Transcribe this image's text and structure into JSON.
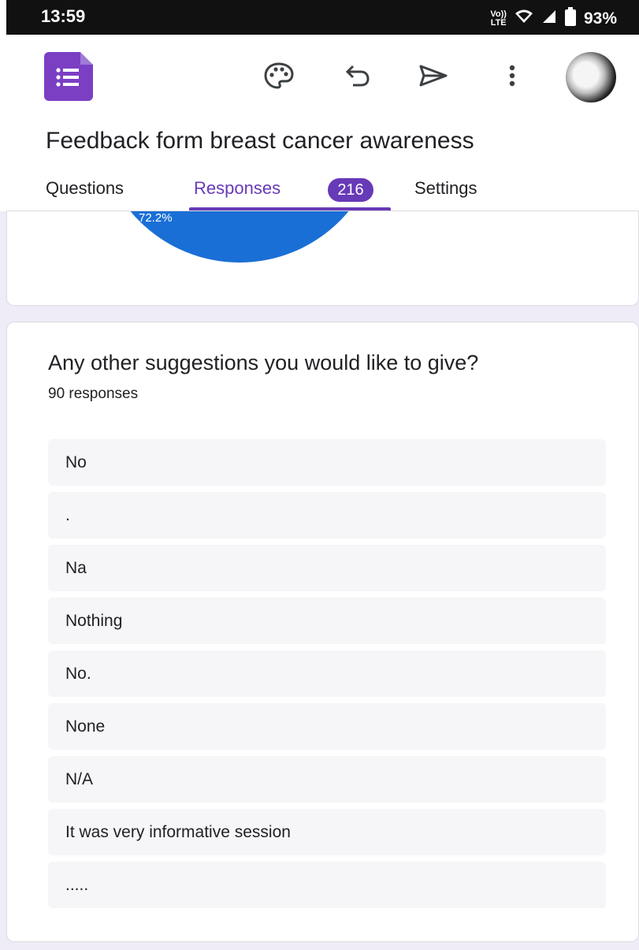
{
  "status_bar": {
    "time": "13:59",
    "network_label": "Vo)) LTE",
    "battery_percent": "93%"
  },
  "app_bar": {
    "icons": [
      "forms-logo-icon",
      "palette-icon",
      "undo-icon",
      "send-icon",
      "more-vert-icon",
      "avatar"
    ]
  },
  "form": {
    "title": "Feedback form breast cancer awareness"
  },
  "tabs": [
    {
      "label": "Questions",
      "active": false
    },
    {
      "label": "Responses",
      "active": true,
      "badge": "216"
    },
    {
      "label": "Settings",
      "active": false
    }
  ],
  "pie_chart": {
    "label": "72.2%",
    "color": "#1a6fd6"
  },
  "question_card": {
    "question": "Any other suggestions you would like to give?",
    "response_count": "90 responses",
    "responses": [
      "No",
      ".",
      "Na",
      "Nothing",
      "No.",
      "None",
      "N/A",
      "It was very informative session",
      "....."
    ]
  },
  "colors": {
    "accent": "#673ab7",
    "background": "#efebf7",
    "status_bar": "#111111"
  }
}
